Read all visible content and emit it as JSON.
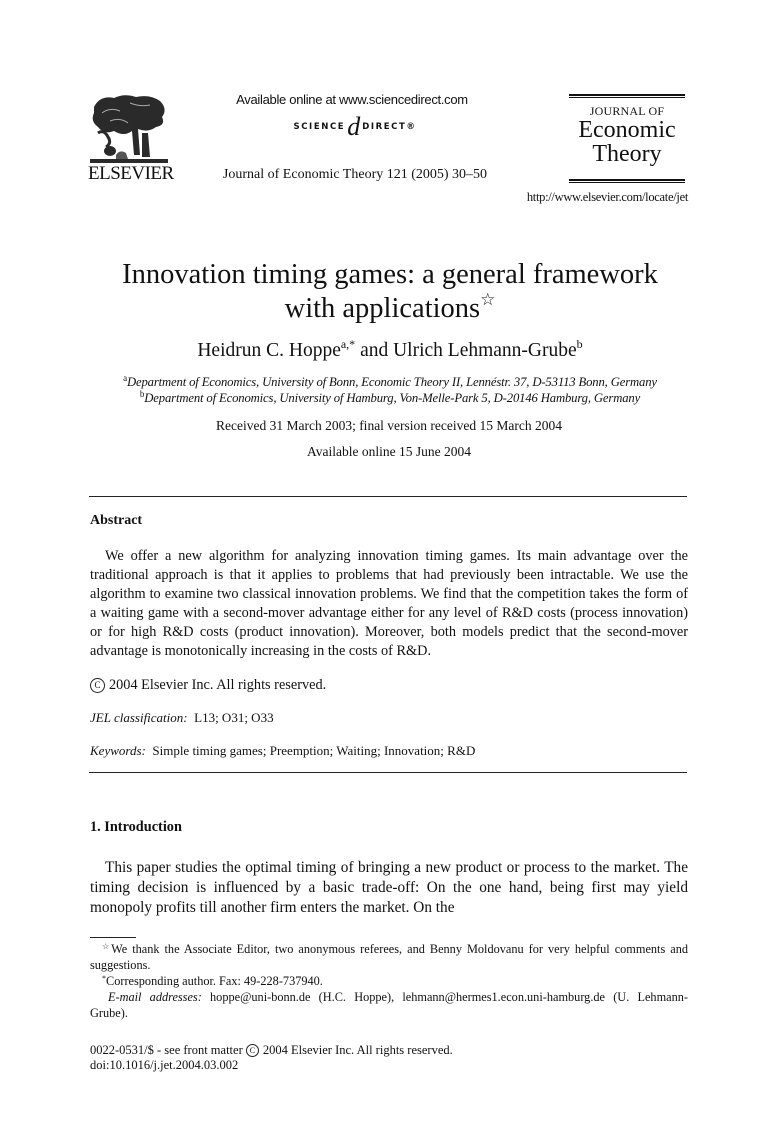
{
  "header": {
    "publisher_logo_icon": "elsevier-tree-icon",
    "publisher_name": "ELSEVIER",
    "sciencedirect_available": "Available online at www.sciencedirect.com",
    "sciencedirect_left": "SCIENCE",
    "sciencedirect_at": "d",
    "sciencedirect_right": "DIRECT®",
    "journal_citation": "Journal of Economic Theory 121 (2005) 30–50",
    "journal_logo": {
      "line1": "JOURNAL OF",
      "line2": "Economic",
      "line3": "Theory"
    },
    "journal_url": "http://www.elsevier.com/locate/jet"
  },
  "article": {
    "title_line1": "Innovation timing games: a general framework",
    "title_line2": "with applications",
    "title_note_mark": "☆",
    "authors": [
      {
        "name": "Heidrun C. Hoppe",
        "marks": "a,*"
      },
      {
        "name": "Ulrich Lehmann-Grube",
        "marks": "b"
      }
    ],
    "author_connector": "and",
    "affiliations": [
      {
        "mark": "a",
        "text": "Department of Economics, University of Bonn, Economic Theory II, Lennéstr. 37, D-53113 Bonn, Germany"
      },
      {
        "mark": "b",
        "text": "Department of Economics, University of Hamburg, Von-Melle-Park 5, D-20146 Hamburg, Germany"
      }
    ],
    "received": "Received 31 March 2003; final version received 15 March 2004",
    "available_online": "Available online 15 June 2004"
  },
  "abstract": {
    "heading": "Abstract",
    "body": "We offer a new algorithm for analyzing innovation timing games. Its main advantage over the traditional approach is that it applies to problems that had previously been intractable. We use the algorithm to examine two classical innovation problems. We find that the competition takes the form of a waiting game with a second-mover advantage either for any level of R&D costs (process innovation) or for high R&D costs (product innovation). Moreover, both models predict that the second-mover advantage is monotonically increasing in the costs of R&D.",
    "copyright_symbol": "C",
    "copyright": "2004 Elsevier Inc. All rights reserved.",
    "jel_label": "JEL classification:",
    "jel_codes": "L13; O31; O33",
    "keywords_label": "Keywords:",
    "keywords": "Simple timing games; Preemption; Waiting; Innovation; R&D"
  },
  "introduction": {
    "heading": "1.  Introduction",
    "body": "This paper studies the optimal timing of bringing a new product or process to the market. The timing decision is influenced by a basic trade-off: On the one hand, being first may yield monopoly profits till another firm enters the market. On the"
  },
  "footnotes": {
    "star_mark": "☆",
    "star_text": "We thank the Associate Editor, two anonymous referees, and Benny Moldovanu for very helpful comments and suggestions.",
    "corresponding_mark": "*",
    "corresponding_text": "Corresponding author. Fax: 49-228-737940.",
    "email_label": "E-mail addresses:",
    "email_text": "hoppe@uni-bonn.de (H.C. Hoppe), lehmann@hermes1.econ.uni-hamburg.de (U. Lehmann-Grube)."
  },
  "bottom": {
    "issn_prefix": "0022-0531/$ - see front matter",
    "copyright_symbol": "C",
    "issn_suffix": "2004 Elsevier Inc. All rights reserved.",
    "doi": "doi:10.1016/j.jet.2004.03.002"
  }
}
